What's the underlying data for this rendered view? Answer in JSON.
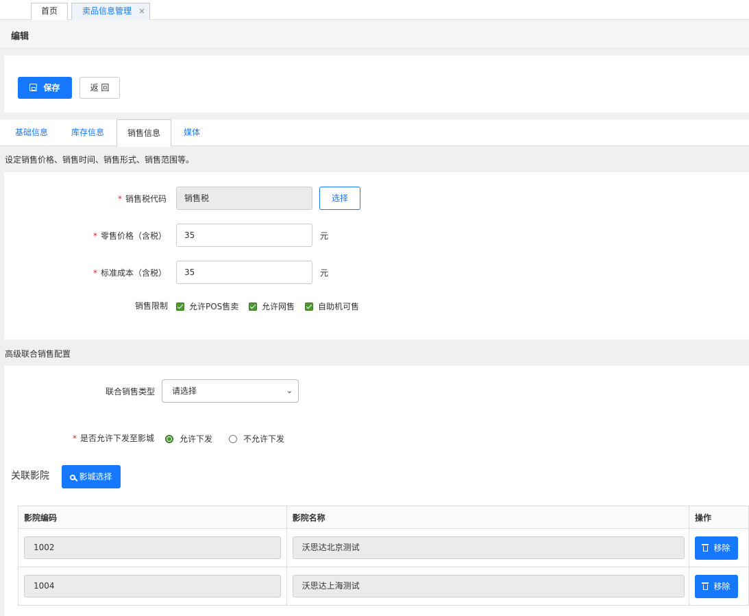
{
  "top_tabs": {
    "home": "首页",
    "active": "卖品信息管理",
    "close": "×"
  },
  "page": {
    "title": "编辑"
  },
  "toolbar": {
    "save": "保存",
    "back": "返 回"
  },
  "tabs": [
    "基础信息",
    "库存信息",
    "销售信息",
    "媒体"
  ],
  "section": {
    "desc": "设定销售价格、销售时间、销售形式、销售范围等。"
  },
  "form": {
    "tax_code_label": "销售税代码",
    "tax_code_value": "销售税",
    "choose": "选择",
    "retail_price_label": "零售价格（含税）",
    "retail_price_value": "35",
    "std_cost_label": "标准成本（含税）",
    "std_cost_value": "35",
    "unit": "元",
    "limit_label": "销售限制",
    "limits": [
      "允许POS售卖",
      "允许网售",
      "自助机可售"
    ]
  },
  "advanced": {
    "title": "高级联合销售配置",
    "type_label": "联合销售类型",
    "type_value": "请选择",
    "dispatch_label": "是否允许下发至影城",
    "allow": "允许下发",
    "disallow": "不允许下发",
    "cinema_title": "关联影院",
    "cinema_select": "影城选择"
  },
  "table": {
    "headers": [
      "影院编码",
      "影院名称",
      "操作"
    ],
    "rows": [
      {
        "code": "1002",
        "name": "沃思达北京测试",
        "action": "移除"
      },
      {
        "code": "1004",
        "name": "沃思达上海测试",
        "action": "移除"
      }
    ]
  },
  "colors": {
    "primary": "#1677ff",
    "required": "#e02020",
    "checkbox": "#4a9a2e"
  }
}
